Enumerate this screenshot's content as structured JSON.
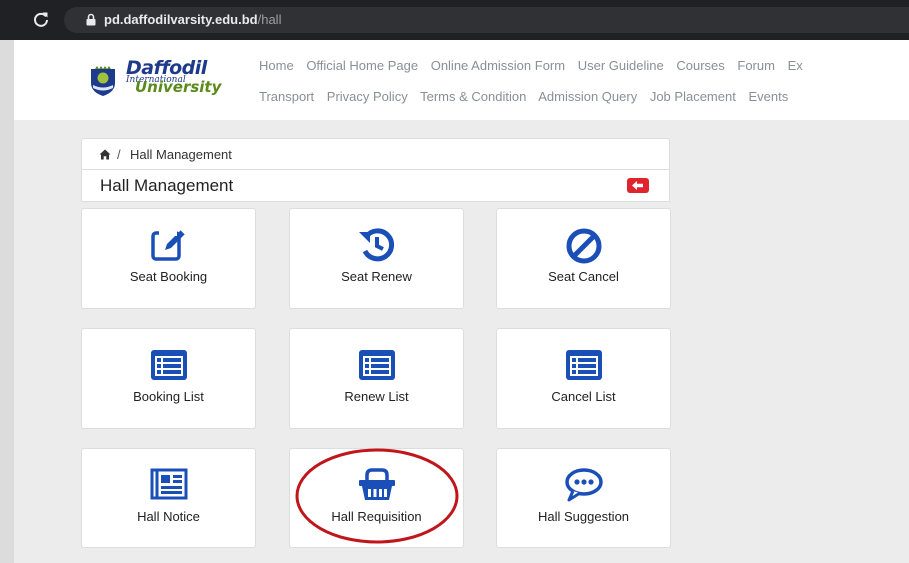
{
  "browser": {
    "url_domain": "pd.daffodilvarsity.edu.bd",
    "url_path": "/hall"
  },
  "logo": {
    "line1": "Daffodil",
    "line2": "International",
    "line3": "University"
  },
  "nav": {
    "row1": [
      "Home",
      "Official Home Page",
      "Online Admission Form",
      "User Guideline",
      "Courses",
      "Forum",
      "Ex"
    ],
    "row2": [
      "Transport",
      "Privacy Policy",
      "Terms & Condition",
      "Admission Query",
      "Job Placement",
      "Events"
    ]
  },
  "breadcrumb": {
    "separator": "/",
    "current": "Hall Management"
  },
  "panel": {
    "title": "Hall Management"
  },
  "tiles": {
    "seat_booking": {
      "label": "Seat Booking",
      "icon": "edit-icon"
    },
    "seat_renew": {
      "label": "Seat Renew",
      "icon": "history-icon"
    },
    "seat_cancel": {
      "label": "Seat Cancel",
      "icon": "ban-icon"
    },
    "booking_list": {
      "label": "Booking List",
      "icon": "list-icon"
    },
    "renew_list": {
      "label": "Renew List",
      "icon": "list-icon"
    },
    "cancel_list": {
      "label": "Cancel List",
      "icon": "list-icon"
    },
    "hall_notice": {
      "label": "Hall Notice",
      "icon": "newspaper-icon"
    },
    "hall_requisition": {
      "label": "Hall Requisition",
      "icon": "basket-icon"
    },
    "hall_suggestion": {
      "label": "Hall Suggestion",
      "icon": "chat-icon"
    }
  },
  "colors": {
    "icon_blue": "#1a4fb8",
    "back_button_red": "#e0242c",
    "highlight_ring_red": "#c0151b"
  }
}
